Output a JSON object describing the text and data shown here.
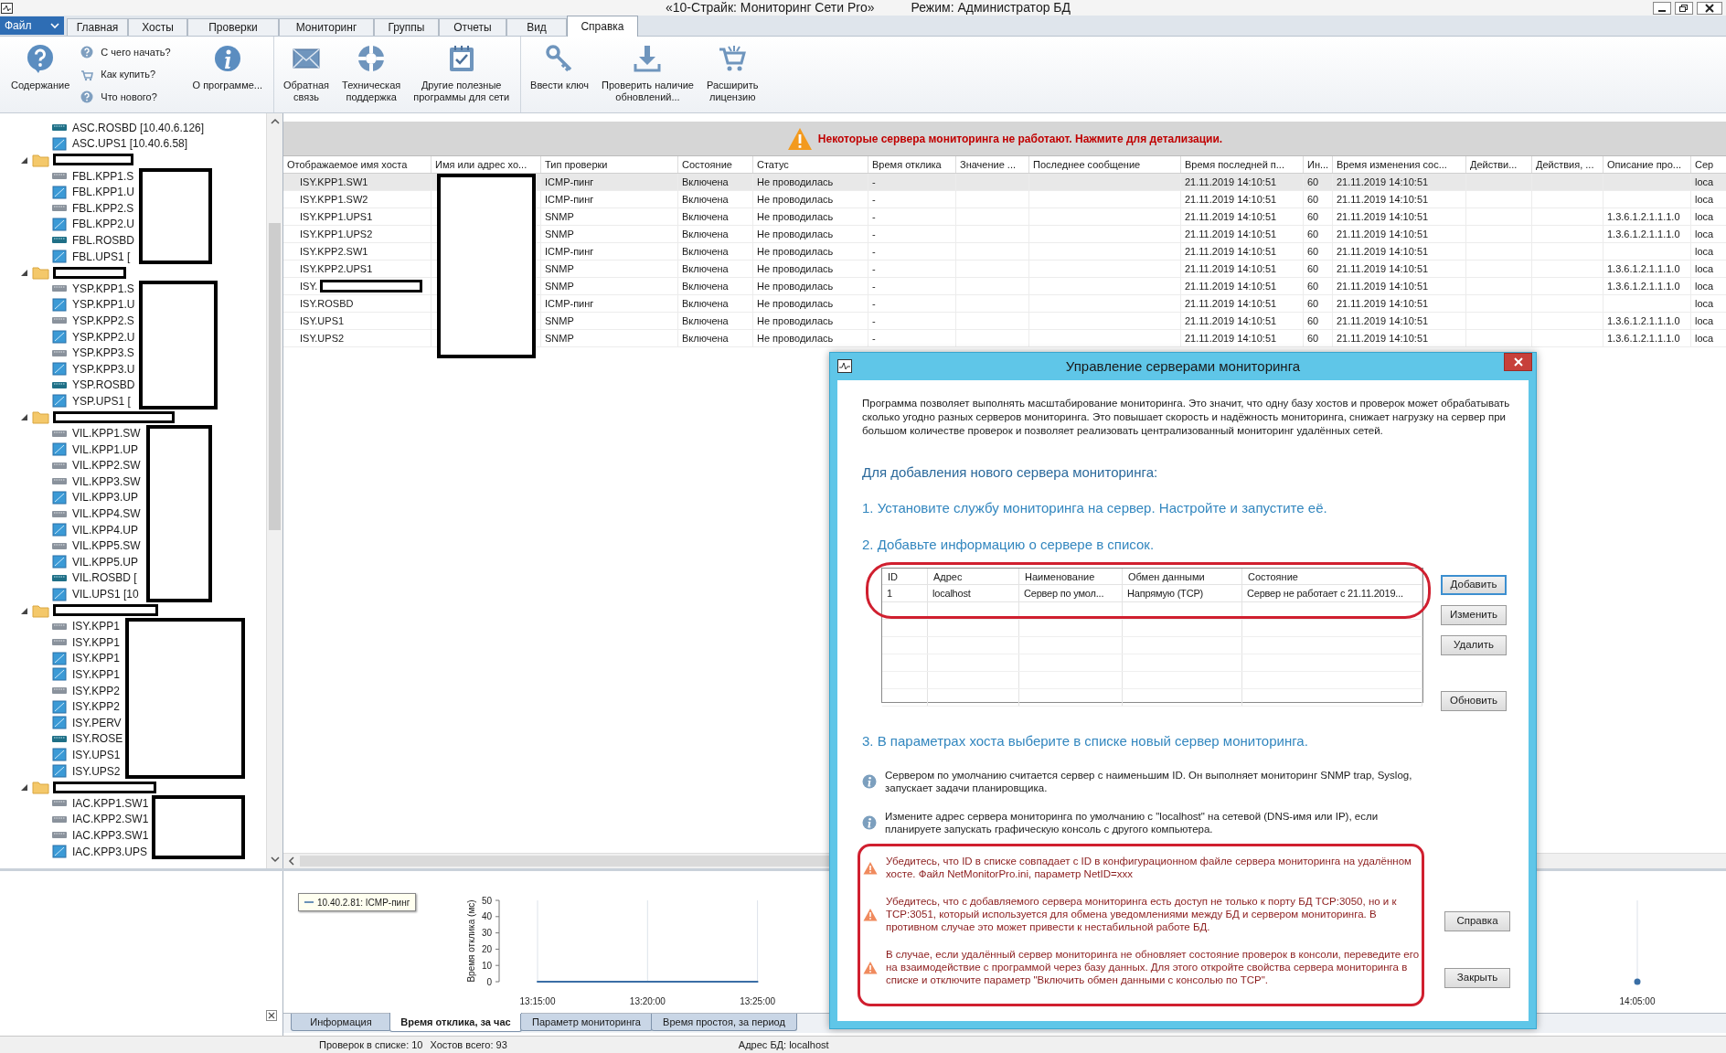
{
  "window": {
    "title": "«10-Страйк: Мониторинг Сети Pro»",
    "mode": "Режим: Администратор БД"
  },
  "menu_tabs": [
    {
      "label": "Файл",
      "kind": "file",
      "selected": false
    },
    {
      "label": "Главная",
      "kind": "tab",
      "selected": false
    },
    {
      "label": "Хосты",
      "kind": "tab",
      "selected": false
    },
    {
      "label": "Проверки",
      "kind": "tab",
      "selected": false
    },
    {
      "label": "Мониторинг",
      "kind": "tab",
      "selected": false
    },
    {
      "label": "Группы",
      "kind": "tab",
      "selected": false
    },
    {
      "label": "Отчеты",
      "kind": "tab",
      "selected": false
    },
    {
      "label": "Вид",
      "kind": "tab",
      "selected": false
    },
    {
      "label": "Справка",
      "kind": "tab",
      "selected": true
    }
  ],
  "ribbon": {
    "groups": [
      {
        "items": [
          {
            "kind": "large",
            "label": "Содержание"
          },
          {
            "kind": "stack",
            "items": [
              "С чего начать?",
              "Как купить?",
              "Что нового?"
            ]
          },
          {
            "kind": "large",
            "label": "О программе..."
          }
        ]
      },
      {
        "items": [
          {
            "kind": "large",
            "label": "Обратная\nсвязь"
          },
          {
            "kind": "large",
            "label": "Техническая\nподдержка"
          },
          {
            "kind": "large",
            "label": "Другие полезные\nпрограммы для сети"
          }
        ]
      },
      {
        "items": [
          {
            "kind": "large",
            "label": "Ввести ключ"
          },
          {
            "kind": "large",
            "label": "Проверить наличие\nобновлений..."
          },
          {
            "kind": "large",
            "label": "Расширить\nлицензию"
          }
        ]
      }
    ]
  },
  "tree": [
    {
      "kind": "server",
      "label": "ASC.ROSBD [10.40.6.126]"
    },
    {
      "kind": "ups",
      "label": "ASC.UPS1 [10.40.6.58]"
    },
    {
      "kind": "group",
      "expanded": true,
      "children": [
        {
          "kind": "switch",
          "label": "FBL.KPP1.S"
        },
        {
          "kind": "ups",
          "label": "FBL.KPP1.U"
        },
        {
          "kind": "switch",
          "label": "FBL.KPP2.S"
        },
        {
          "kind": "ups",
          "label": "FBL.KPP2.U"
        },
        {
          "kind": "server",
          "label": "FBL.ROSBD"
        },
        {
          "kind": "ups",
          "label": "FBL.UPS1 ["
        }
      ]
    },
    {
      "kind": "group",
      "expanded": true,
      "children": [
        {
          "kind": "switch",
          "label": "YSP.KPP1.S"
        },
        {
          "kind": "ups",
          "label": "YSP.KPP1.U"
        },
        {
          "kind": "switch",
          "label": "YSP.KPP2.S"
        },
        {
          "kind": "ups",
          "label": "YSP.KPP2.U"
        },
        {
          "kind": "switch",
          "label": "YSP.KPP3.S"
        },
        {
          "kind": "ups",
          "label": "YSP.KPP3.U"
        },
        {
          "kind": "server",
          "label": "YSP.ROSBD"
        },
        {
          "kind": "ups",
          "label": "YSP.UPS1 ["
        }
      ]
    },
    {
      "kind": "group",
      "expanded": true,
      "children": [
        {
          "kind": "switch",
          "label": "VIL.KPP1.SW"
        },
        {
          "kind": "ups",
          "label": "VIL.KPP1.UP"
        },
        {
          "kind": "switch",
          "label": "VIL.KPP2.SW"
        },
        {
          "kind": "switch",
          "label": "VIL.KPP3.SW"
        },
        {
          "kind": "ups",
          "label": "VIL.KPP3.UP"
        },
        {
          "kind": "switch",
          "label": "VIL.KPP4.SW"
        },
        {
          "kind": "ups",
          "label": "VIL.KPP4.UP"
        },
        {
          "kind": "switch",
          "label": "VIL.KPP5.SW"
        },
        {
          "kind": "ups",
          "label": "VIL.KPP5.UP"
        },
        {
          "kind": "server",
          "label": "VIL.ROSBD ["
        },
        {
          "kind": "ups",
          "label": "VIL.UPS1 [10"
        }
      ]
    },
    {
      "kind": "group",
      "expanded": true,
      "children": [
        {
          "kind": "switch",
          "label": "ISY.KPP1"
        },
        {
          "kind": "switch",
          "label": "ISY.KPP1"
        },
        {
          "kind": "ups",
          "label": "ISY.KPP1"
        },
        {
          "kind": "ups",
          "label": "ISY.KPP1"
        },
        {
          "kind": "switch",
          "label": "ISY.KPP2"
        },
        {
          "kind": "ups",
          "label": "ISY.KPP2"
        },
        {
          "kind": "ups",
          "label": "ISY.PERV"
        },
        {
          "kind": "server",
          "label": "ISY.ROSE"
        },
        {
          "kind": "ups",
          "label": "ISY.UPS1"
        },
        {
          "kind": "ups",
          "label": "ISY.UPS2"
        }
      ]
    },
    {
      "kind": "group",
      "expanded": true,
      "children": [
        {
          "kind": "switch",
          "label": "IAC.KPP1.SW1"
        },
        {
          "kind": "switch",
          "label": "IAC.KPP2.SW1"
        },
        {
          "kind": "switch",
          "label": "IAC.KPP3.SW1"
        },
        {
          "kind": "ups",
          "label": "IAC.KPP3.UPS"
        }
      ]
    }
  ],
  "alert": "Некоторые сервера мониторинга не работают. Нажмите для детализации.",
  "table": {
    "columns": [
      "Отображаемое имя хоста",
      "Имя или адрес хо...",
      "Тип проверки",
      "Состояние",
      "Статус",
      "Время отклика",
      "Значение ...",
      "Последнее сообщение",
      "Время последней п...",
      "Ин...",
      "Время изменения сос...",
      "Действи...",
      "Действия, ...",
      "Описание про...",
      "Сер"
    ],
    "rows": [
      {
        "selected": true,
        "redacted": false,
        "cells": [
          "ISY.KPP1.SW1",
          null,
          "ICMP-пинг",
          "Включена",
          "Не проводилась",
          "-",
          null,
          null,
          "21.11.2019 14:10:51",
          "60",
          "21.11.2019 14:10:51",
          null,
          null,
          null,
          "loca"
        ]
      },
      {
        "selected": false,
        "redacted": false,
        "cells": [
          "ISY.KPP1.SW2",
          null,
          "ICMP-пинг",
          "Включена",
          "Не проводилась",
          "-",
          null,
          null,
          "21.11.2019 14:10:51",
          "60",
          "21.11.2019 14:10:51",
          null,
          null,
          null,
          "loca"
        ]
      },
      {
        "selected": false,
        "redacted": false,
        "cells": [
          "ISY.KPP1.UPS1",
          null,
          "SNMP",
          "Включена",
          "Не проводилась",
          "-",
          null,
          null,
          "21.11.2019 14:10:51",
          "60",
          "21.11.2019 14:10:51",
          null,
          null,
          "1.3.6.1.2.1.1.1.0",
          "loca"
        ]
      },
      {
        "selected": false,
        "redacted": false,
        "cells": [
          "ISY.KPP1.UPS2",
          null,
          "SNMP",
          "Включена",
          "Не проводилась",
          "-",
          null,
          null,
          "21.11.2019 14:10:51",
          "60",
          "21.11.2019 14:10:51",
          null,
          null,
          "1.3.6.1.2.1.1.1.0",
          "loca"
        ]
      },
      {
        "selected": false,
        "redacted": false,
        "cells": [
          "ISY.KPP2.SW1",
          null,
          "ICMP-пинг",
          "Включена",
          "Не проводилась",
          "-",
          null,
          null,
          "21.11.2019 14:10:51",
          "60",
          "21.11.2019 14:10:51",
          null,
          null,
          null,
          "loca"
        ]
      },
      {
        "selected": false,
        "redacted": false,
        "cells": [
          "ISY.KPP2.UPS1",
          null,
          "SNMP",
          "Включена",
          "Не проводилась",
          "-",
          null,
          null,
          "21.11.2019 14:10:51",
          "60",
          "21.11.2019 14:10:51",
          null,
          null,
          "1.3.6.1.2.1.1.1.0",
          "loca"
        ]
      },
      {
        "selected": false,
        "redacted": true,
        "cells": [
          "ISY.",
          null,
          "SNMP",
          "Включена",
          "Не проводилась",
          "-",
          null,
          null,
          "21.11.2019 14:10:51",
          "60",
          "21.11.2019 14:10:51",
          null,
          null,
          "1.3.6.1.2.1.1.1.0",
          "loca"
        ]
      },
      {
        "selected": false,
        "redacted": false,
        "cells": [
          "ISY.ROSBD",
          null,
          "ICMP-пинг",
          "Включена",
          "Не проводилась",
          "-",
          null,
          null,
          "21.11.2019 14:10:51",
          "60",
          "21.11.2019 14:10:51",
          null,
          null,
          null,
          "loca"
        ]
      },
      {
        "selected": false,
        "redacted": false,
        "cells": [
          "ISY.UPS1",
          null,
          "SNMP",
          "Включена",
          "Не проводилась",
          "-",
          null,
          null,
          "21.11.2019 14:10:51",
          "60",
          "21.11.2019 14:10:51",
          null,
          null,
          "1.3.6.1.2.1.1.1.0",
          "loca"
        ]
      },
      {
        "selected": false,
        "redacted": false,
        "cells": [
          "ISY.UPS2",
          null,
          "SNMP",
          "Включена",
          "Не проводилась",
          "-",
          null,
          null,
          "21.11.2019 14:10:51",
          "60",
          "21.11.2019 14:10:51",
          null,
          null,
          "1.3.6.1.2.1.1.1.0",
          "loca"
        ]
      }
    ]
  },
  "chart": {
    "chart_data": {
      "type": "line",
      "grid": true,
      "ylabel": "Время отклика (мс)",
      "categories": [
        "13:15:00",
        "13:20:00",
        "13:25:00",
        null,
        null,
        null,
        null,
        null,
        null,
        null,
        "14:05:00"
      ],
      "series": [
        {
          "name": "10.40.2.81: ICMP-пинг",
          "color": "#3a6ea5",
          "values": [
            0,
            0,
            0,
            null,
            null,
            null,
            null,
            null,
            null,
            null,
            0
          ]
        }
      ],
      "ylim": [
        0,
        50
      ],
      "yticks": [
        0,
        10,
        20,
        30,
        40,
        50
      ]
    }
  },
  "bottom_tabs": [
    {
      "label": "Информация",
      "selected": false
    },
    {
      "label": "Время отклика, за час",
      "selected": true
    },
    {
      "label": "Параметр мониторинга",
      "selected": false
    },
    {
      "label": "Время простоя, за период",
      "selected": false
    }
  ],
  "status_bar": [
    "Проверок в списке: 10",
    "Хостов всего: 93",
    "Адрес БД: localhost"
  ],
  "dialog": {
    "title": "Управление серверами мониторинга",
    "intro": "Программа позволяет выполнять масштабирование мониторинга. Это значит, что одну базу хостов и проверок может обрабатывать сколько угодно разных серверов мониторинга. Это повышает скорость и надёжность мониторинга, снижает нагрузку на сервер при большом количестве проверок и позволяет реализовать централизованный мониторинг удалённых сетей.",
    "heading": "Для добавления нового сервера мониторинга:",
    "steps": [
      "1. Установите службу мониторинга на сервер. Настройте и запустите её.",
      "2. Добавьте информацию о сервере в список.",
      "3. В параметрах хоста выберите в списке новый сервер мониторинга."
    ],
    "servers": {
      "columns": [
        "ID",
        "Адрес",
        "Наименование",
        "Обмен данными",
        "Состояние"
      ],
      "rows": [
        {
          "selected": false,
          "cells": [
            "1",
            "localhost",
            "Сервер по умол...",
            "Напрямую (TCP)",
            "Сервер не работает с 21.11.2019..."
          ]
        }
      ]
    },
    "side_buttons": [
      {
        "label": "Добавить",
        "focused": true
      },
      {
        "label": "Изменить",
        "focused": false
      },
      {
        "label": "Удалить",
        "focused": false
      },
      {
        "label": "Обновить",
        "focused": false
      }
    ],
    "notes": [
      {
        "kind": "info",
        "text": "Сервером по умолчанию считается сервер с наименьшим ID. Он выполняет мониторинг SNMP trap, Syslog, запускает задачи планировщика."
      },
      {
        "kind": "info",
        "text": "Измените адрес сервера мониторинга по умолчанию с \"localhost\" на сетевой (DNS-имя или IP), если планируете запускать графическую консоль с другого компьютера."
      },
      {
        "kind": "warning",
        "text": "Убедитесь, что ID в списке совпадает с ID в конфигурационном файле сервера мониторинга на удалённом хосте. Файл NetMonitorPro.ini, параметр NetID=xxx"
      },
      {
        "kind": "warning",
        "text": "Убедитесь, что с добавляемого сервера мониторинга есть доступ не только к порту БД TCP:3050, но и к TCP:3051, который используется для обмена уведомлениями между БД и сервером мониторинга. В противном случае это может привести к нестабильной работе БД."
      },
      {
        "kind": "warning",
        "text": "В случае, если удалённый сервер мониторинга не обновляет состояние проверок в консоли, переведите его на взаимодействие с программой через базу данных. Для этого откройте свойства сервера мониторинга в списке и отключите параметр \"Включить обмен данными с консолью по TCP\"."
      }
    ],
    "footer_buttons": [
      {
        "label": "Справка",
        "focused": false
      },
      {
        "label": "Закрыть",
        "focused": false
      }
    ]
  }
}
